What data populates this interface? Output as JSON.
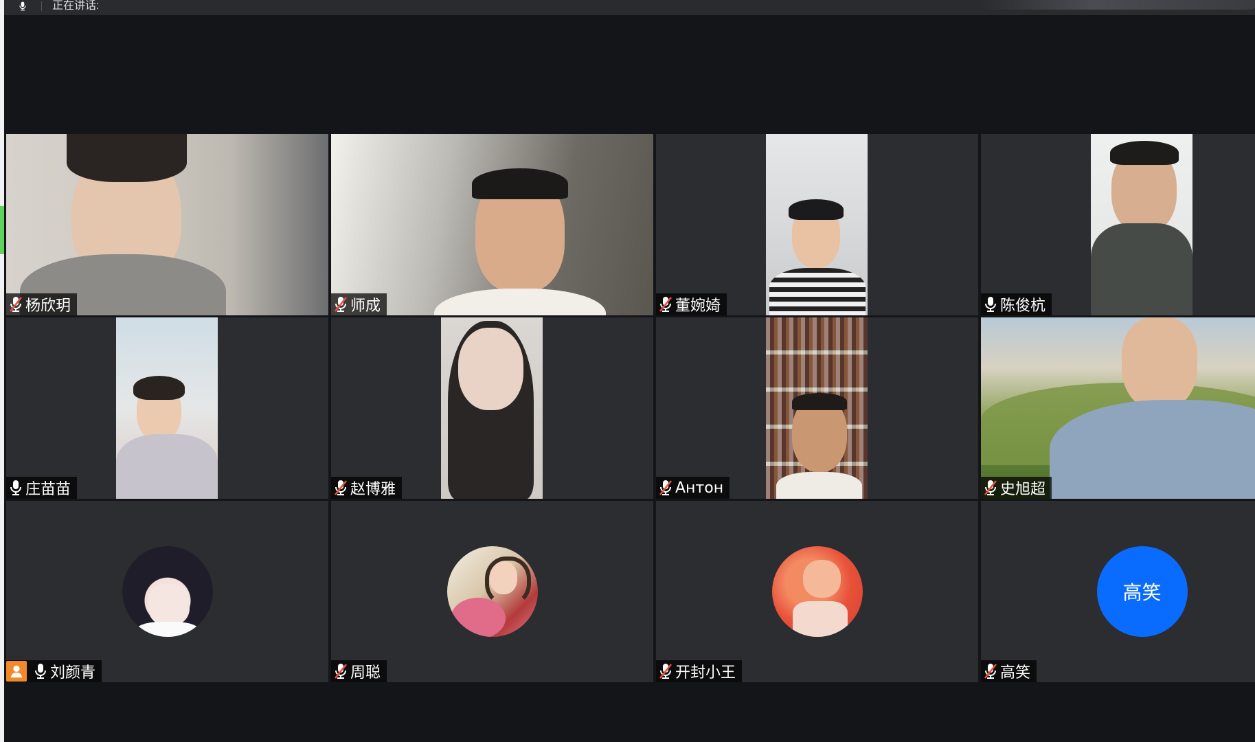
{
  "app": {
    "status_text": "正在讲话:"
  },
  "colors": {
    "background": "#141518",
    "tile": "#2b2d31",
    "name_tag_bg": "#000000b8",
    "mic_muted": "#e8503a",
    "initials_avatar": "#0a6cff",
    "host_badge": "#f08a2a"
  },
  "participants": [
    {
      "name": "杨欣玥",
      "mic": "muted",
      "media": "video"
    },
    {
      "name": "师成",
      "mic": "muted",
      "media": "video"
    },
    {
      "name": "董婉婍",
      "mic": "muted",
      "media": "video"
    },
    {
      "name": "陈俊杭",
      "mic": "on",
      "media": "video"
    },
    {
      "name": "庄苗苗",
      "mic": "on",
      "media": "video"
    },
    {
      "name": "赵博雅",
      "mic": "muted",
      "media": "video"
    },
    {
      "name": "Антон",
      "mic": "muted",
      "media": "video"
    },
    {
      "name": "史旭超",
      "mic": "muted",
      "media": "video"
    },
    {
      "name": "刘颜青",
      "mic": "on",
      "media": "avatar",
      "host": true
    },
    {
      "name": "周聪",
      "mic": "muted",
      "media": "avatar"
    },
    {
      "name": "开封小王",
      "mic": "muted",
      "media": "avatar"
    },
    {
      "name": "高笑",
      "mic": "muted",
      "media": "initials",
      "initials": "高笑"
    }
  ]
}
